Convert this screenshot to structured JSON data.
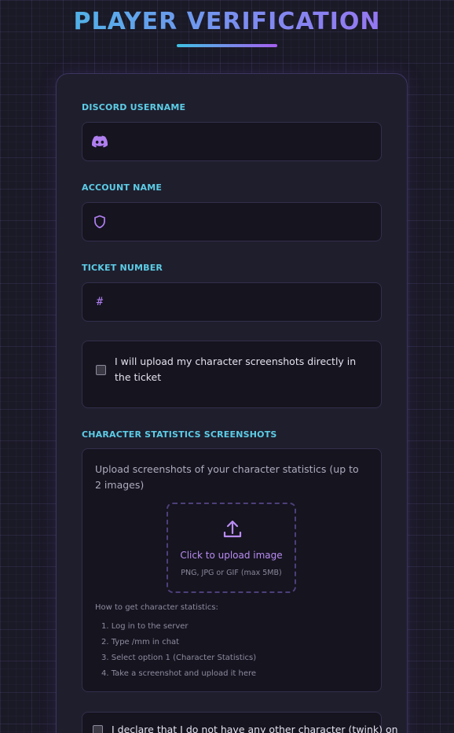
{
  "page": {
    "title": "PLAYER VERIFICATION"
  },
  "form": {
    "discord": {
      "label": "DISCORD USERNAME",
      "value": "",
      "placeholder": ""
    },
    "account": {
      "label": "ACCOUNT NAME",
      "value": "",
      "placeholder": ""
    },
    "ticket": {
      "label": "TICKET NUMBER",
      "value": "",
      "placeholder": "",
      "prefix": "#"
    },
    "upload_in_ticket": {
      "text": "I will upload my character screenshots directly in the ticket",
      "checked": false
    },
    "screenshots": {
      "label": "CHARACTER STATISTICS SCREENSHOTS",
      "description": "Upload screenshots of your character statistics (up to 2 images)",
      "dropzone_title": "Click to upload image",
      "dropzone_hint": "PNG, JPG or GIF (max 5MB)",
      "howto_title": "How to get character statistics:",
      "steps": [
        "1. Log in to the server",
        "2. Type /mm in chat",
        "3. Select option 1 (Character Statistics)",
        "4. Take a screenshot and upload it here"
      ]
    },
    "declaration": {
      "text": "I declare that I do not have any other character (twink) on",
      "checked": false
    }
  },
  "colors": {
    "accent_cyan": "#5ccde6",
    "accent_purple": "#b07ff0",
    "background": "#1a1926",
    "card": "#1f1e2d",
    "field": "#15141f"
  },
  "icons": {
    "discord": "discord-icon",
    "account": "shield-icon",
    "ticket": "hash-icon",
    "upload": "upload-icon"
  }
}
